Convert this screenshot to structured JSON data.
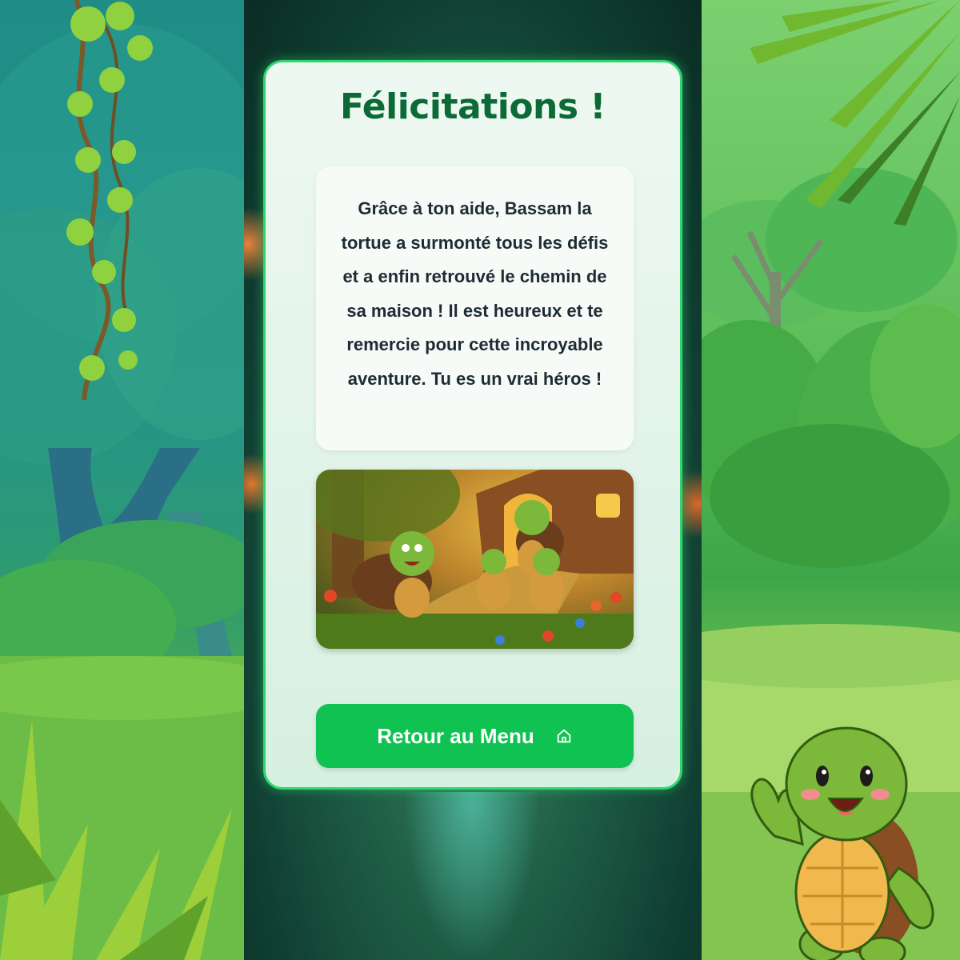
{
  "card": {
    "title": "Félicitations !",
    "message": "Grâce à ton aide, Bassam la tortue a surmonté tous les défis et a enfin retrouvé le chemin de sa maison ! Il est heureux et te remercie pour cette incroyable aventure. Tu es un vrai héros !",
    "button_label": "Retour au Menu",
    "button_icon": "home-icon"
  },
  "colors": {
    "accent": "#10c251",
    "title": "#0b6a35",
    "card_border": "#2ed66d"
  }
}
